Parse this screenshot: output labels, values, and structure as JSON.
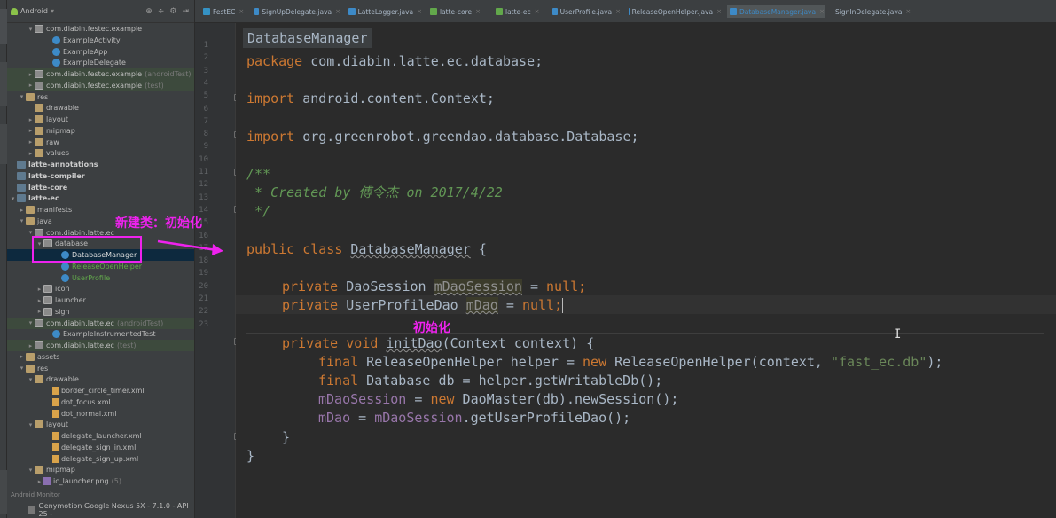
{
  "project_panel": {
    "view_label": "Android",
    "tree": [
      {
        "label": "com.diabin.festec.example",
        "indent": 2,
        "icon": "pkg",
        "arrow": "▾"
      },
      {
        "label": "ExampleActivity",
        "indent": 4,
        "icon": "cls"
      },
      {
        "label": "ExampleApp",
        "indent": 4,
        "icon": "cls"
      },
      {
        "label": "ExampleDelegate",
        "indent": 4,
        "icon": "cls"
      },
      {
        "label": "com.diabin.festec.example",
        "suffix": "(androidTest)",
        "indent": 2,
        "icon": "pkg",
        "arrow": "▸",
        "hl": true
      },
      {
        "label": "com.diabin.festec.example",
        "suffix": "(test)",
        "indent": 2,
        "icon": "pkg",
        "arrow": "▸",
        "hl": true
      },
      {
        "label": "res",
        "indent": 1,
        "icon": "folder",
        "arrow": "▾"
      },
      {
        "label": "drawable",
        "indent": 2,
        "icon": "folder"
      },
      {
        "label": "layout",
        "indent": 2,
        "icon": "folder",
        "arrow": "▸"
      },
      {
        "label": "mipmap",
        "indent": 2,
        "icon": "folder",
        "arrow": "▸"
      },
      {
        "label": "raw",
        "indent": 2,
        "icon": "folder",
        "arrow": "▸"
      },
      {
        "label": "values",
        "indent": 2,
        "icon": "folder",
        "arrow": "▸"
      },
      {
        "label": "latte-annotations",
        "indent": 0,
        "icon": "module",
        "bold": true
      },
      {
        "label": "latte-compiler",
        "indent": 0,
        "icon": "module",
        "bold": true
      },
      {
        "label": "latte-core",
        "indent": 0,
        "icon": "module",
        "bold": true
      },
      {
        "label": "latte-ec",
        "indent": 0,
        "icon": "module",
        "bold": true,
        "arrow": "▾"
      },
      {
        "label": "manifests",
        "indent": 1,
        "icon": "folder",
        "arrow": "▸"
      },
      {
        "label": "java",
        "indent": 1,
        "icon": "folder",
        "arrow": "▾"
      },
      {
        "label": "com.diabin.latte.ec",
        "indent": 2,
        "icon": "pkg",
        "arrow": "▾"
      },
      {
        "label": "database",
        "indent": 3,
        "icon": "pkg",
        "arrow": "▾"
      },
      {
        "label": "DatabaseManager",
        "indent": 5,
        "icon": "cls",
        "sel": true
      },
      {
        "label": "ReleaseOpenHelper",
        "indent": 5,
        "icon": "cls",
        "green": true
      },
      {
        "label": "UserProfile",
        "indent": 5,
        "icon": "cls",
        "green": true
      },
      {
        "label": "icon",
        "indent": 3,
        "icon": "pkg",
        "arrow": "▸"
      },
      {
        "label": "launcher",
        "indent": 3,
        "icon": "pkg",
        "arrow": "▸"
      },
      {
        "label": "sign",
        "indent": 3,
        "icon": "pkg",
        "arrow": "▸"
      },
      {
        "label": "com.diabin.latte.ec",
        "suffix": "(androidTest)",
        "indent": 2,
        "icon": "pkg",
        "arrow": "▾",
        "hl": true
      },
      {
        "label": "ExampleInstrumentedTest",
        "indent": 4,
        "icon": "cls"
      },
      {
        "label": "com.diabin.latte.ec",
        "suffix": "(test)",
        "indent": 2,
        "icon": "pkg",
        "arrow": "▸",
        "hl": true
      },
      {
        "label": "assets",
        "indent": 1,
        "icon": "folder",
        "arrow": "▸"
      },
      {
        "label": "res",
        "indent": 1,
        "icon": "folder",
        "arrow": "▾"
      },
      {
        "label": "drawable",
        "indent": 2,
        "icon": "folder",
        "arrow": "▾"
      },
      {
        "label": "border_circle_timer.xml",
        "indent": 4,
        "icon": "xml"
      },
      {
        "label": "dot_focus.xml",
        "indent": 4,
        "icon": "xml"
      },
      {
        "label": "dot_normal.xml",
        "indent": 4,
        "icon": "xml"
      },
      {
        "label": "layout",
        "indent": 2,
        "icon": "folder",
        "arrow": "▾"
      },
      {
        "label": "delegate_launcher.xml",
        "indent": 4,
        "icon": "xml"
      },
      {
        "label": "delegate_sign_in.xml",
        "indent": 4,
        "icon": "xml"
      },
      {
        "label": "delegate_sign_up.xml",
        "indent": 4,
        "icon": "xml"
      },
      {
        "label": "mipmap",
        "indent": 2,
        "icon": "folder",
        "arrow": "▾"
      },
      {
        "label": "ic_launcher.png",
        "suffix": "(5)",
        "indent": 3,
        "icon": "png",
        "arrow": "▸"
      }
    ],
    "monitor_label": "Android Monitor",
    "device_label": "Genymotion Google Nexus 5X - 7.1.0 - API 25 -"
  },
  "tabs": [
    {
      "label": "FestEC",
      "color": "#3592c4"
    },
    {
      "label": "SignUpDelegate.java",
      "color": "#3d8ac7"
    },
    {
      "label": "LatteLogger.java",
      "color": "#3d8ac7"
    },
    {
      "label": "latte-core",
      "color": "#62a84b"
    },
    {
      "label": "latte-ec",
      "color": "#62a84b"
    },
    {
      "label": "UserProfile.java",
      "color": "#3d8ac7"
    },
    {
      "label": "ReleaseOpenHelper.java",
      "color": "#3d8ac7"
    },
    {
      "label": "DatabaseManager.java",
      "color": "#3d8ac7",
      "active": true
    },
    {
      "label": "SignInDelegate.java",
      "color": "#3d8ac7"
    }
  ],
  "editor": {
    "breadcrumb": "DatabaseManager",
    "line_numbers": [
      "1",
      "2",
      "3",
      "4",
      "5",
      "6",
      "7",
      "8",
      "9",
      "10",
      "11",
      "12",
      "13",
      "14",
      "15",
      "16",
      "17",
      "18",
      "19",
      "20",
      "21",
      "22",
      "23"
    ],
    "code": {
      "package_kw": "package",
      "package_name": " com.diabin.latte.ec.database;",
      "import_kw": "import",
      "import1": " android.content.Context;",
      "import2": " org.greenrobot.greendao.database.Database;",
      "doc_open": "/**",
      "doc_line": " * Created by 傅令杰 on 2017/4/22",
      "doc_close": " */",
      "public_kw": "public",
      "class_kw": " class ",
      "class_name": "DatabaseManager",
      "class_open": " {",
      "private_kw": "private",
      "type_session": " DaoSession ",
      "field_session": "mDaoSession",
      "assign": " = ",
      "null_kw": "null",
      "semi": ";",
      "type_dao": " UserProfileDao ",
      "field_dao": "mDao",
      "void_kw": " void ",
      "method_name": "initDao",
      "method_params": "(Context context) {",
      "final_kw": "final",
      "helper_decl": " ReleaseOpenHelper helper = ",
      "new_kw": "new",
      "helper_ctor": " ReleaseOpenHelper(context, ",
      "db_string": "\"fast_ec.db\"",
      "helper_end": ");",
      "db_decl": " Database db = helper.getWritableDb();",
      "session_assign": " = ",
      "session_ctor": " DaoMaster(db).newSession();",
      "dao_assign": " = ",
      "dao_get": ".getUserProfileDao();",
      "close_method": "}",
      "close_class": "}"
    }
  },
  "annotations": {
    "new_class_note": "新建类：初始化",
    "init_note": "初始化",
    "color": "#ee22ee"
  }
}
